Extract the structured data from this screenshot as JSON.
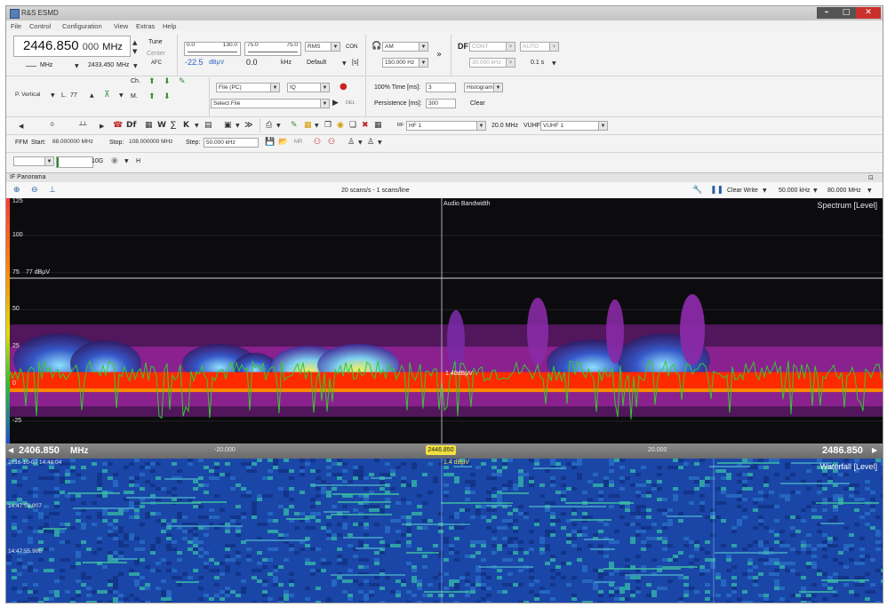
{
  "window": {
    "title": "R&S ESMD"
  },
  "menu": [
    "File",
    "Control",
    "Configuration",
    "View",
    "Extras",
    "Help"
  ],
  "receiver": {
    "frequency_main": "2446.850",
    "frequency_fine": "000",
    "frequency_unit": "MHz",
    "tune_label": "Tune",
    "center_label": "Center",
    "afc_label": "AFC",
    "step_unit": "MHz",
    "second_freq": "2433.450",
    "second_unit": "MHz"
  },
  "level": {
    "scale_a_min": "0.0",
    "scale_a_max": "130.0",
    "scale_b_min": "75.0",
    "scale_b_max": "75.0",
    "level_value": "-22.5",
    "level_unit": "dBµV",
    "offset_value": "0.0",
    "offset_unit": "kHz",
    "detector": "RMS",
    "detector_mode": "Default",
    "con_label": "CON",
    "s_label": "[s]"
  },
  "demod": {
    "mode": "AM",
    "bandwidth": "150.000 Hz"
  },
  "df": {
    "label": "DF",
    "mode": "CONT",
    "auto": "AUTO",
    "bw": "30.000 kHz",
    "time": "0.1 s"
  },
  "row2": {
    "polarization": "P. Vertical",
    "l_value": "77",
    "file_source": "File (PC)",
    "iq": "IQ",
    "select_file": "Select File",
    "del_label": "DEL",
    "time_label": "100% Time [ms]:",
    "time_value": "3",
    "persistence_label": "Persistence [ms]:",
    "persistence_value": "300",
    "histogram": "Histogram",
    "clear": "Clear",
    "ch_label": "Ch.",
    "m_label": "M."
  },
  "row3": {
    "counter": "0",
    "antenna": "HF 1",
    "span": "20.0 MHz",
    "vuhf_label": "VUHF",
    "vuhf": "VUHF 1"
  },
  "ffm": {
    "label": "FFM",
    "start_label": "Start:",
    "start": "88.000000 MHz",
    "stop_label": "Stop:",
    "stop": "108.000000 MHz",
    "step_label": "Step:",
    "step": "50.000 kHz"
  },
  "row5": {
    "attn": "10G",
    "h_label": "H"
  },
  "panorama": {
    "title": "IF Panorama",
    "scan_rate": "20 scans/s - 1 scans/line",
    "clear_mode": "Clear Write",
    "resolution": "50.000 kHz",
    "span": "80.000 MHz"
  },
  "spectrum": {
    "title": "Spectrum [Level]",
    "marker_label": "Audio Bandwidth",
    "threshold_label": "77 dBµV",
    "marker_level": "1.40dBµV",
    "y_ticks": [
      "125",
      "100",
      "75",
      "50",
      "25",
      "0",
      "-25"
    ],
    "colors": {
      "background": "#0c0c0f",
      "trace": "#ff2a00",
      "peak": "#36c830",
      "persistence": "#8a1f9c"
    }
  },
  "axis": {
    "left_freq": "2406.850",
    "left_unit": "MHz",
    "center_freq": "2446.850",
    "center_level": "1.4 dBµV",
    "tick_left": "-20.000",
    "tick_right": "20.000",
    "right_freq": "2486.850"
  },
  "waterfall": {
    "title": "Waterfall [Level]",
    "timestamps": [
      "2016-10-07 14:48:04",
      "14:47:59.907",
      "14:47:55.906"
    ]
  }
}
